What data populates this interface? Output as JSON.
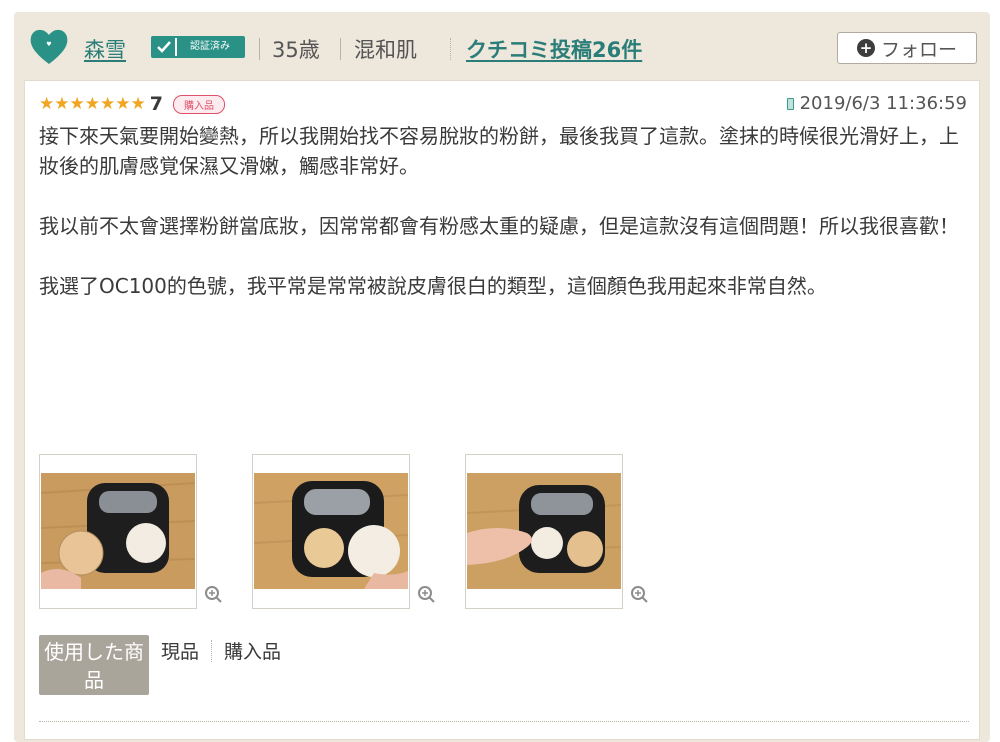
{
  "reviewer": {
    "name": "森雪",
    "verified_badge": "認証済み",
    "age": "35歳",
    "skin_type": "混和肌",
    "posts_link": "クチコミ投稿26件",
    "follow_label": "フォロー",
    "avatar_icon": "heart-avatar-icon",
    "accent_color": "#2a9187"
  },
  "review": {
    "stars": 7,
    "rating_label": "7",
    "purchase_tag": "購入品",
    "timestamp": "2019/6/3 11:36:59",
    "paragraphs": [
      "接下來天氣要開始變熱，所以我開始找不容易脫妝的粉餅，最後我買了這款。塗抹的時候很光滑好上，上妝後的肌膚感覚保濕又滑嫩，觸感非常好。",
      "我以前不太會選擇粉餅當底妝，因常常都會有粉感太重的疑慮，但是這款沒有這個問題！所以我很喜歡！",
      "我選了OC100的色號，我平常是常常被說皮膚很白的類型，這個顏色我用起來非常自然。"
    ],
    "photos": [
      "photo-1",
      "photo-2",
      "photo-3"
    ],
    "used_product_label": "使用した商品",
    "used_values": [
      "現品",
      "購入品"
    ]
  }
}
